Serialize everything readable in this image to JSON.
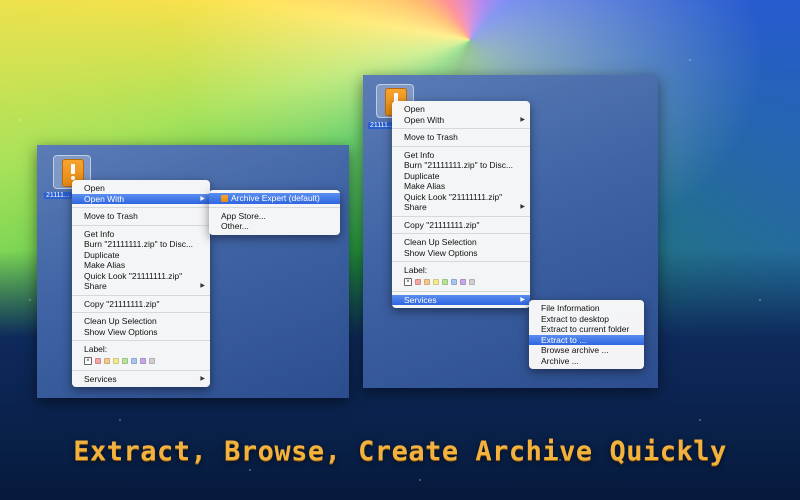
{
  "tagline": "Extract, Browse, Create Archive Quickly",
  "file_name": "21111111.zip",
  "left_panel": {
    "file_label": "21111...",
    "menu": {
      "items": [
        {
          "label": "Open"
        },
        {
          "label": "Open With",
          "submenu": true,
          "highlighted": true
        },
        {
          "label": "Move to Trash"
        },
        {
          "label": "Get Info"
        },
        {
          "label": "Burn \"21111111.zip\" to Disc..."
        },
        {
          "label": "Duplicate"
        },
        {
          "label": "Make Alias"
        },
        {
          "label": "Quick Look \"21111111.zip\""
        },
        {
          "label": "Share",
          "submenu": true
        },
        {
          "label": "Copy \"21111111.zip\""
        },
        {
          "label": "Clean Up Selection"
        },
        {
          "label": "Show View Options"
        },
        {
          "label": "Label:"
        },
        {
          "label": "Services",
          "submenu": true
        }
      ]
    },
    "submenu": {
      "items": [
        {
          "label": "Archive Expert (default)",
          "highlighted": true
        },
        {
          "label": "App Store..."
        },
        {
          "label": "Other..."
        }
      ]
    }
  },
  "right_panel": {
    "file_label": "21111...",
    "menu": {
      "items": [
        {
          "label": "Open"
        },
        {
          "label": "Open With",
          "submenu": true
        },
        {
          "label": "Move to Trash"
        },
        {
          "label": "Get Info"
        },
        {
          "label": "Burn \"21111111.zip\" to Disc..."
        },
        {
          "label": "Duplicate"
        },
        {
          "label": "Make Alias"
        },
        {
          "label": "Quick Look \"21111111.zip\""
        },
        {
          "label": "Share",
          "submenu": true
        },
        {
          "label": "Copy \"21111111.zip\""
        },
        {
          "label": "Clean Up Selection"
        },
        {
          "label": "Show View Options"
        },
        {
          "label": "Label:"
        },
        {
          "label": "Services",
          "submenu": true,
          "highlighted": true
        }
      ]
    },
    "submenu": {
      "items": [
        {
          "label": "File Information"
        },
        {
          "label": "Extract to desktop"
        },
        {
          "label": "Extract to current folder"
        },
        {
          "label": "Extract to ...",
          "highlighted": true
        },
        {
          "label": "Browse archive ..."
        },
        {
          "label": "Archive ..."
        }
      ]
    }
  },
  "label_colors": [
    "#f6a3a3",
    "#f6c98a",
    "#f3ea8a",
    "#b9e29a",
    "#a7c6f0",
    "#c7a9e6",
    "#cfcfcf"
  ],
  "highlight_color": "#2f66e0",
  "tagline_color": "#f3b23e"
}
